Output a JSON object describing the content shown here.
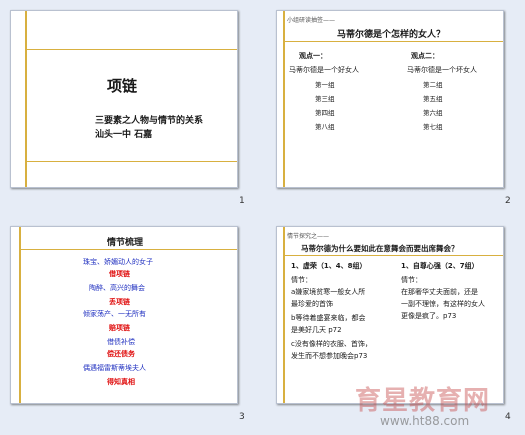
{
  "slides": [
    {
      "number": "1",
      "title": "项链",
      "subtitle": "三要素之人物与情节的关系",
      "author": "汕头一中 石嘉"
    },
    {
      "number": "2",
      "header": "小组研读抽签——",
      "question": "马蒂尔德是个怎样的女人？",
      "col1_title": "观点一：",
      "col1_line": "马蒂尔德是一个好女人",
      "col1_groups": [
        "第一组",
        "第三组",
        "第四组",
        "第八组"
      ],
      "col2_title": "观点二：",
      "col2_line": "马蒂尔德是一个坏女人",
      "col2_groups": [
        "第二组",
        "第五组",
        "第六组",
        "第七组"
      ]
    },
    {
      "number": "3",
      "title": "情节梳理",
      "lines": [
        {
          "text": "珠宝、娇媚动人的女子",
          "color": "blue"
        },
        {
          "text": "借项链",
          "color": "red"
        },
        {
          "text": "陶醉、高兴的舞会",
          "color": "blue"
        },
        {
          "text": "丢项链",
          "color": "red"
        },
        {
          "text": "倾家荡产、一无所有",
          "color": "blue"
        },
        {
          "text": "赔项链",
          "color": "red"
        },
        {
          "text": "借债补偿",
          "color": "blue"
        },
        {
          "text": "偿还债务",
          "color": "red"
        },
        {
          "text": "偶遇福雷斯蒂埃夫人",
          "color": "blue"
        },
        {
          "text": "得知真相",
          "color": "red"
        }
      ]
    },
    {
      "number": "4",
      "header": "情节探究之——",
      "question": "马蒂尔德为什么要如此在意舞会而要出席舞会？",
      "left_title": "1、虚荣（1、4、8组）",
      "left_lines": [
        "情节：",
        "a嫌家境贫寒一般女人所",
        "最珍爱的首饰",
        "b等待着盛宴来临，都会",
        "是美好几天 p72",
        "c没有像样的衣服、首饰，",
        "发生而不想参加晚会p73"
      ],
      "right_title": "1、自尊心强（2、7组）",
      "right_lines": [
        "情节：",
        "在那奢华丈夫面前，还是",
        "一副不理惊，有这样的女人",
        "更像是疯了。p73"
      ]
    }
  ],
  "watermark": {
    "text": "育星教育网",
    "url": "www.ht88.com"
  }
}
